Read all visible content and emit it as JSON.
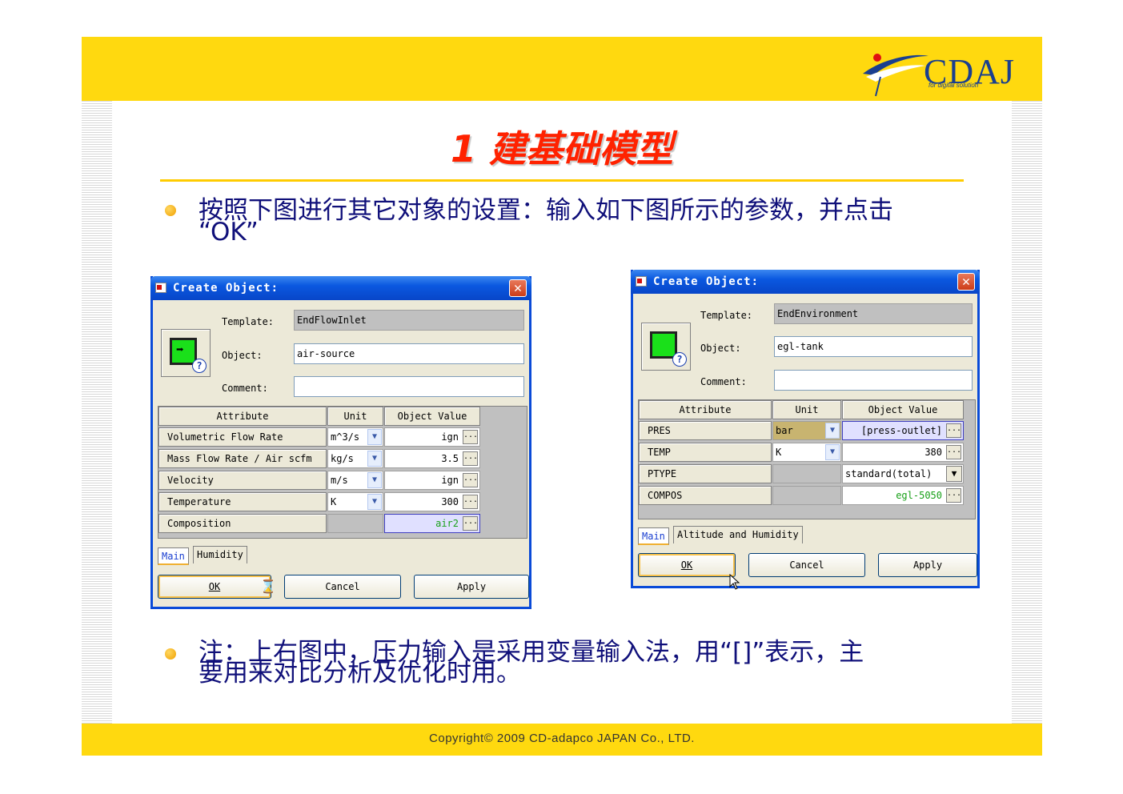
{
  "header": {
    "logo_text": "CDAJ",
    "logo_sub": "for digital solution"
  },
  "title": "1 建基础模型",
  "bullets": [
    {
      "line1": "按照下图进行其它对象的设置：输入如下图所示的参数，并点击",
      "line2": "“OK”"
    },
    {
      "line1": "注：上右图中，压力输入是采用变量输入法，用“[]”表示，主",
      "line2": "要用来对比分析及优化时用。"
    }
  ],
  "footer": {
    "copyright": "Copyright© 2009 CD-adapco JAPAN Co., LTD."
  },
  "dialog_left": {
    "title": "Create Object:",
    "template_label": "Template:",
    "template_value": "EndFlowInlet",
    "object_label": "Object:",
    "object_value": "air-source",
    "comment_label": "Comment:",
    "comment_value": "",
    "columns": [
      "Attribute",
      "Unit",
      "Object Value"
    ],
    "rows": [
      {
        "attr": "Volumetric Flow Rate",
        "unit": "m^3/s",
        "value": "ign"
      },
      {
        "attr": "Mass Flow Rate / Air scfm",
        "unit": "kg/s",
        "value": "3.5"
      },
      {
        "attr": "Velocity",
        "unit": "m/s",
        "value": "ign"
      },
      {
        "attr": "Temperature",
        "unit": "K",
        "value": "300"
      },
      {
        "attr": "Composition",
        "unit": "",
        "value": "air2"
      }
    ],
    "tabs": [
      "Main",
      "Humidity"
    ],
    "buttons": {
      "ok": "OK",
      "cancel": "Cancel",
      "apply": "Apply"
    }
  },
  "dialog_right": {
    "title": "Create Object:",
    "template_label": "Template:",
    "template_value": "EndEnvironment",
    "object_label": "Object:",
    "object_value": "egl-tank",
    "comment_label": "Comment:",
    "comment_value": "",
    "columns": [
      "Attribute",
      "Unit",
      "Object Value"
    ],
    "rows": [
      {
        "attr": "PRES",
        "unit": "bar",
        "value": "[press-outlet]"
      },
      {
        "attr": "TEMP",
        "unit": "K",
        "value": "380"
      },
      {
        "attr": "PTYPE",
        "unit": "",
        "value": "standard(total)"
      },
      {
        "attr": "COMPOS",
        "unit": "",
        "value": "egl-5050"
      }
    ],
    "tabs": [
      "Main",
      "Altitude and Humidity"
    ],
    "buttons": {
      "ok": "OK",
      "cancel": "Cancel",
      "apply": "Apply"
    }
  },
  "colors": {
    "header_yellow": "#ffd90f",
    "title_red": "#ff2200",
    "text_blue": "#10107a",
    "xp_blue": "#0a58e0"
  }
}
